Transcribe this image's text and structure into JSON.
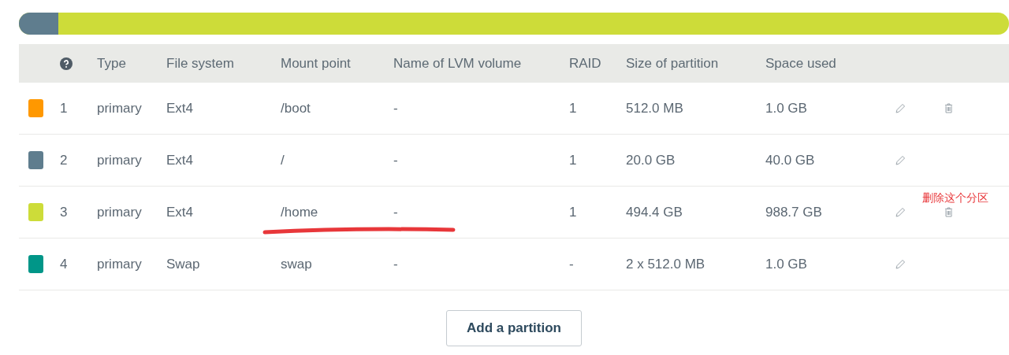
{
  "usage_bar": {
    "level": 0.04
  },
  "table": {
    "columns": [
      "Type",
      "File system",
      "Mount point",
      "Name of LVM volume",
      "RAID",
      "Size of partition",
      "Space used"
    ],
    "rows": [
      {
        "color": "#ff9800",
        "number": "1",
        "type": "primary",
        "file_system": "Ext4",
        "mount_point": "/boot",
        "lvm_volume": "-",
        "raid": "1",
        "size": "512.0 MB",
        "space_used": "1.0 GB",
        "deletable": true
      },
      {
        "color": "#5f7d8e",
        "number": "2",
        "type": "primary",
        "file_system": "Ext4",
        "mount_point": "/",
        "lvm_volume": "-",
        "raid": "1",
        "size": "20.0 GB",
        "space_used": "40.0 GB",
        "deletable": false
      },
      {
        "color": "#cddc39",
        "number": "3",
        "type": "primary",
        "file_system": "Ext4",
        "mount_point": "/home",
        "lvm_volume": "-",
        "raid": "1",
        "size": "494.4 GB",
        "space_used": "988.7 GB",
        "deletable": true,
        "note": "删除这个分区",
        "underlined": true
      },
      {
        "color": "#009688",
        "number": "4",
        "type": "primary",
        "file_system": "Swap",
        "mount_point": "swap",
        "lvm_volume": "-",
        "raid": "-",
        "size": "2 x 512.0 MB",
        "space_used": "1.0 GB",
        "deletable": false
      }
    ]
  },
  "add_button": "Add a partition"
}
